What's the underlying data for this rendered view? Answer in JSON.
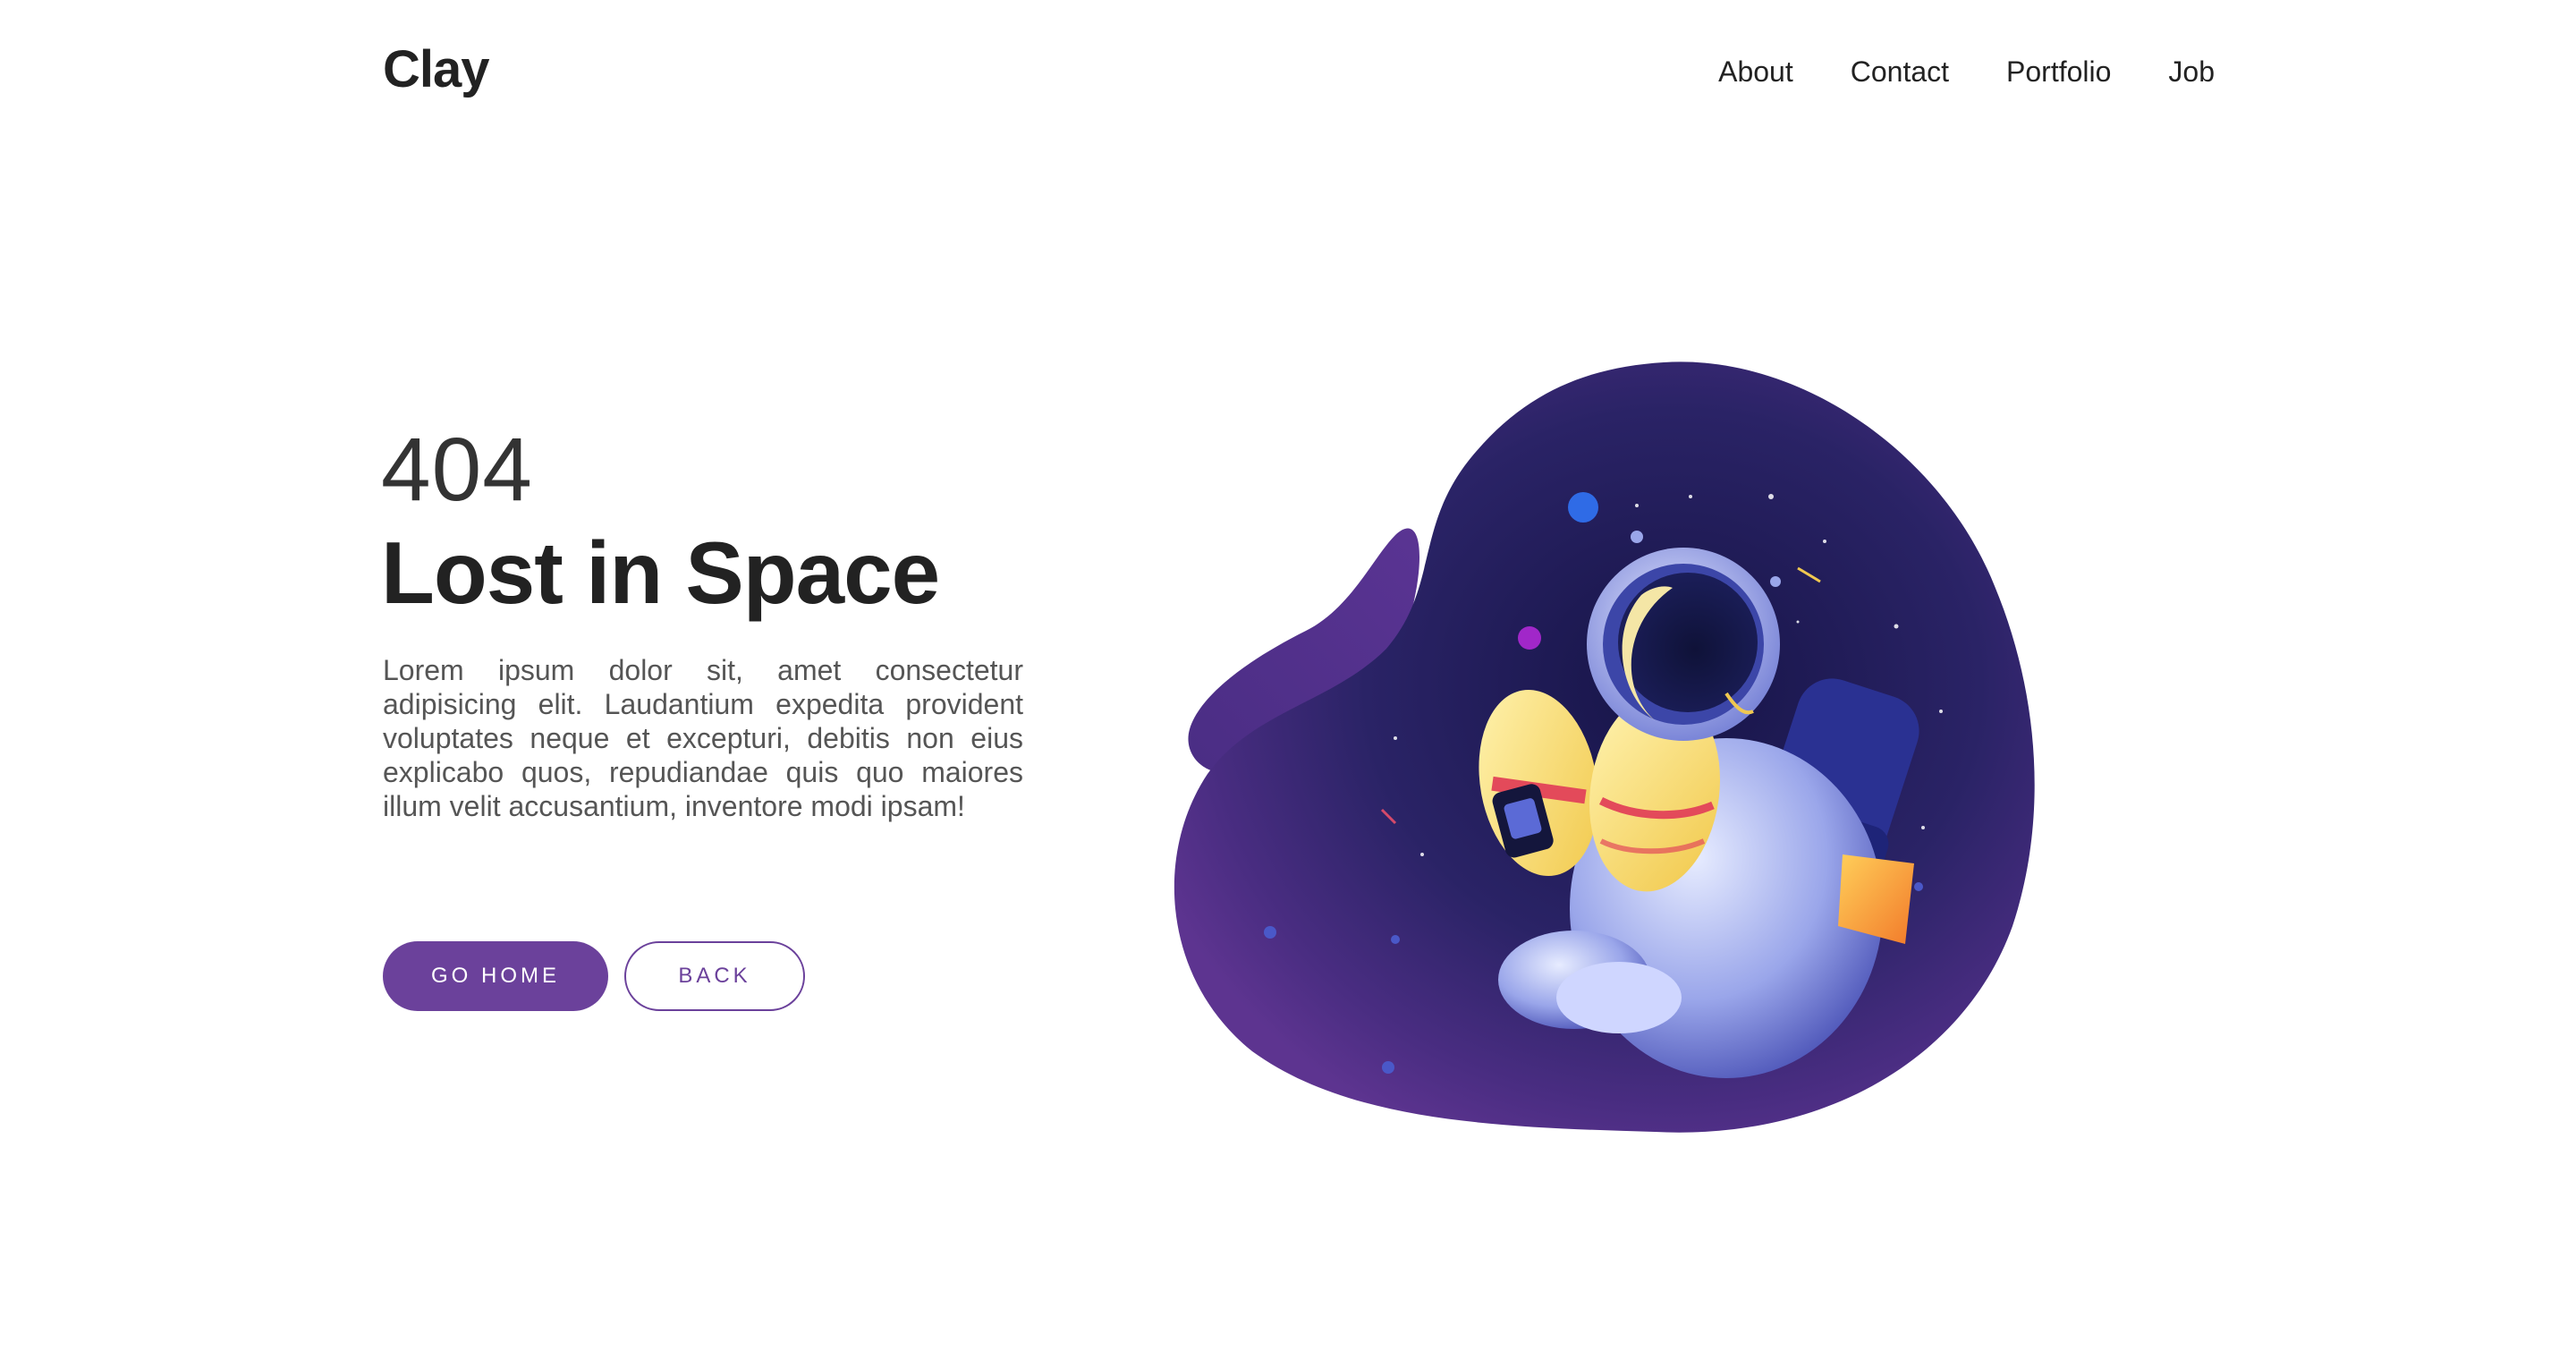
{
  "header": {
    "logo": "Clay",
    "nav": [
      "About",
      "Contact",
      "Portfolio",
      "Job"
    ]
  },
  "hero": {
    "code": "404",
    "title": "Lost in Space",
    "description": "Lorem ipsum dolor sit, amet consectetur adipisicing elit. Laudantium expedita provident voluptates neque et excepturi, debitis non eius explicabo quos, repudiandae quis quo maiores illum velit accusantium, inventore modi ipsam!",
    "buttons": {
      "home": "GO HOME",
      "back": "BACK"
    }
  },
  "colors": {
    "accent": "#6b419b",
    "text": "#222222",
    "muted": "#555555",
    "space_dark": "#1c1a52",
    "space_purple": "#5a2f8a"
  },
  "illustration": {
    "subject": "astronaut-floating-in-space",
    "icons": [
      "astronaut-icon",
      "planet-icon",
      "star-icon"
    ]
  }
}
